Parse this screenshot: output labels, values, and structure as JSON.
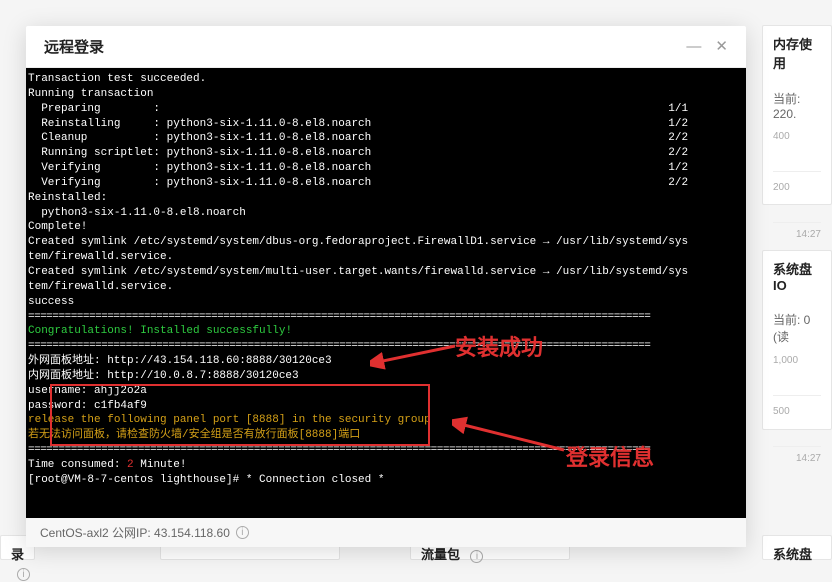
{
  "bg": {
    "right1": {
      "title": "内存使用",
      "sub_prefix": "当前: ",
      "sub_value": "220.",
      "axis1": "400",
      "axis2": "200",
      "time": "14:27"
    },
    "right2": {
      "title": "系统盘IO",
      "sub_prefix": "当前: ",
      "sub_value": "0 (读",
      "axis1": "1,000",
      "axis2": "500",
      "time": "14:27"
    },
    "bottom1": "流量包",
    "bottom2": "系统盘",
    "bottom3": "录"
  },
  "modal": {
    "title": "远程登录",
    "footer_host": "CentOS-axl2 公网IP: 43.154.118.60"
  },
  "terminal": {
    "lines": [
      {
        "t": "Transaction test succeeded."
      },
      {
        "t": "Running transaction"
      },
      {
        "t": "  Preparing        :                                                                             1/1"
      },
      {
        "t": "  Reinstalling     : python3-six-1.11.0-8.el8.noarch                                             1/2"
      },
      {
        "t": "  Cleanup          : python3-six-1.11.0-8.el8.noarch                                             2/2"
      },
      {
        "t": "  Running scriptlet: python3-six-1.11.0-8.el8.noarch                                             2/2"
      },
      {
        "t": "  Verifying        : python3-six-1.11.0-8.el8.noarch                                             1/2"
      },
      {
        "t": "  Verifying        : python3-six-1.11.0-8.el8.noarch                                             2/2"
      },
      {
        "t": ""
      },
      {
        "t": "Reinstalled:"
      },
      {
        "t": "  python3-six-1.11.0-8.el8.noarch"
      },
      {
        "t": ""
      },
      {
        "t": "Complete!"
      },
      {
        "t": "Created symlink /etc/systemd/system/dbus-org.fedoraproject.FirewallD1.service → /usr/lib/systemd/sys"
      },
      {
        "t": "tem/firewalld.service."
      },
      {
        "t": "Created symlink /etc/systemd/system/multi-user.target.wants/firewalld.service → /usr/lib/systemd/sys"
      },
      {
        "t": "tem/firewalld.service."
      },
      {
        "t": "success"
      },
      {
        "t": "======================================================================================================",
        "cls": "hr-line"
      },
      {
        "t": "Congratulations! Installed successfully!",
        "cls": "t-green"
      },
      {
        "t": "======================================================================================================",
        "cls": "hr-line"
      },
      {
        "t": "外网面板地址: http://43.154.118.60:8888/30120ce3"
      },
      {
        "t": "内网面板地址: http://10.0.8.7:8888/30120ce3"
      },
      {
        "t": "username: ahjj2o2a"
      },
      {
        "t": "password: c1fb4af9"
      },
      {
        "t": ""
      },
      {
        "t": "release the following panel port [8888] in the security group",
        "cls": "t-yellow"
      },
      {
        "t": "若无法访问面板，请检查防火墙/安全组是否有放行面板[8888]端口",
        "cls": "t-yellow"
      },
      {
        "t": "======================================================================================================",
        "cls": "hr-line"
      },
      {
        "t_html": "Time consumed: <span class='t-red'>2</span> Minute!"
      },
      {
        "t": "[root@VM-8-7-centos lighthouse]# * Connection closed *"
      }
    ]
  },
  "annotations": {
    "a1": "安装成功",
    "a2": "登录信息"
  }
}
